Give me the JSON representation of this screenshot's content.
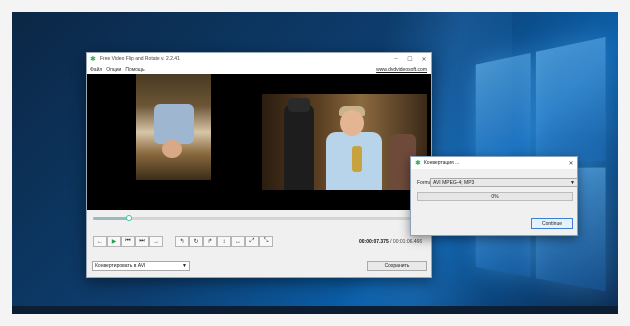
{
  "app": {
    "title": "Free Video Flip and Rotate v. 2.2.41",
    "menu": [
      "Файл",
      "Опции",
      "Помощь"
    ],
    "site_link": "www.dvdvideosoft.com",
    "window_controls": {
      "minimize": "–",
      "maximize": "☐",
      "close": "✕"
    }
  },
  "player": {
    "progress_fraction": 0.11,
    "current_time": "00:00:07.375",
    "separator": "/",
    "total_time": "00:01:06.466",
    "playback_buttons": [
      {
        "icon": "prev-icon",
        "glyph": "←"
      },
      {
        "icon": "play-icon",
        "glyph": "▶"
      },
      {
        "icon": "skip-back-icon",
        "glyph": "⏮"
      },
      {
        "icon": "skip-forward-icon",
        "glyph": "⏭"
      },
      {
        "icon": "next-icon",
        "glyph": "→"
      }
    ],
    "transform_buttons": [
      {
        "icon": "rotate-left-icon",
        "glyph": "↰"
      },
      {
        "icon": "rotate-180-icon",
        "glyph": "↻"
      },
      {
        "icon": "rotate-right-icon",
        "glyph": "↱"
      },
      {
        "icon": "flip-vertical-icon",
        "glyph": "↕"
      },
      {
        "icon": "flip-horizontal-icon",
        "glyph": "↔"
      },
      {
        "icon": "diagonal-flip-icon",
        "glyph": "⤢"
      },
      {
        "icon": "diagonal-flip-alt-icon",
        "glyph": "⤡"
      }
    ]
  },
  "bottom": {
    "convert_select_value": "Конвертировать в AVI",
    "save_label": "Сохранить"
  },
  "dialog": {
    "title": "Конвертация ...",
    "close": "✕",
    "format_label": "Format",
    "format_value": "AVI MPEG-4; MP3",
    "progress_text": "0%",
    "progress_fraction": 0,
    "continue_label": "Continue"
  },
  "colors": {
    "accent": "#2fa84f",
    "progress": "#06b025",
    "desktop": "#0d3d6e"
  }
}
